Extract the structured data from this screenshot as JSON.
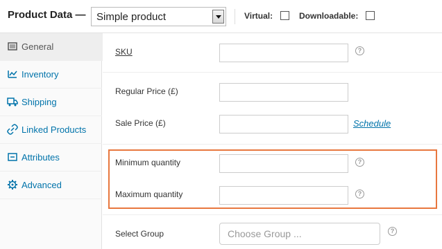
{
  "header": {
    "title": "Product Data —",
    "product_type": "Simple product",
    "virtual_label": "Virtual:",
    "downloadable_label": "Downloadable:"
  },
  "sidebar": {
    "items": [
      {
        "label": "General",
        "icon": "general-icon",
        "active": true
      },
      {
        "label": "Inventory",
        "icon": "inventory-icon",
        "active": false
      },
      {
        "label": "Shipping",
        "icon": "truck-icon",
        "active": false
      },
      {
        "label": "Linked Products",
        "icon": "link-icon",
        "active": false
      },
      {
        "label": "Attributes",
        "icon": "list-icon",
        "active": false
      },
      {
        "label": "Advanced",
        "icon": "gear-icon",
        "active": false
      }
    ]
  },
  "form": {
    "sku_label": "SKU",
    "regular_price_label": "Regular Price (£)",
    "sale_price_label": "Sale Price (£)",
    "schedule_link": "Schedule",
    "min_qty_label": "Minimum quantity",
    "max_qty_label": "Maximum quantity",
    "select_group_label": "Select Group",
    "select_group_placeholder": "Choose Group ...",
    "help_glyph": "?"
  },
  "colors": {
    "link": "#0073aa",
    "highlight_border": "#e8773e"
  }
}
